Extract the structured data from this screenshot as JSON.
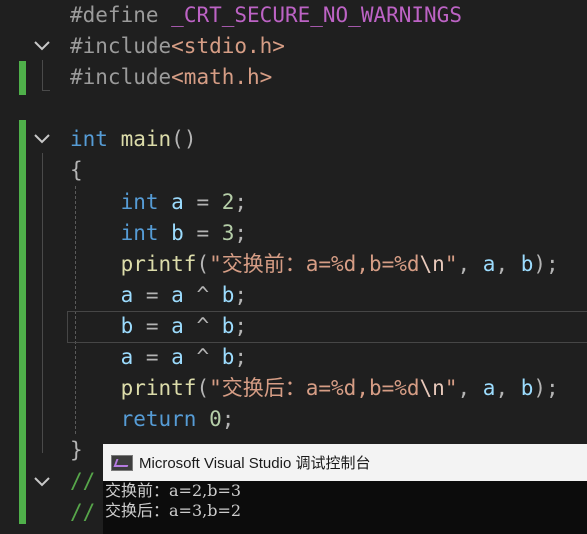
{
  "code": {
    "define_kw": "#define",
    "define_name": "_CRT_SECURE_NO_WARNINGS",
    "include_kw": "#include",
    "include_stdio": "<stdio.h>",
    "include_math": "<math.h>",
    "kw_int": "int",
    "main_name": "main",
    "main_parens": "()",
    "brace_open": "{",
    "brace_close": "}",
    "var_a": "a",
    "var_b": "b",
    "val_2": "2",
    "val_3": "3",
    "printf": "printf",
    "fmt_before": "\"交换前：a=%d,b=%d",
    "fmt_after": "\"交换后：a=%d,b=%d",
    "fmt_escape": "\\n",
    "fmt_quote": "\"",
    "ret_kw": "return",
    "ret_val": "0",
    "comment_start": "//"
  },
  "console": {
    "title": "Microsoft Visual Studio 调试控制台",
    "lines": [
      "交换前：a=2,b=3",
      "交换后：a=3,b=2"
    ]
  },
  "colors": {
    "change_bar": "#4fb04a",
    "editor_bg": "#1f1f1f",
    "console_bg": "#0c0c0c"
  }
}
